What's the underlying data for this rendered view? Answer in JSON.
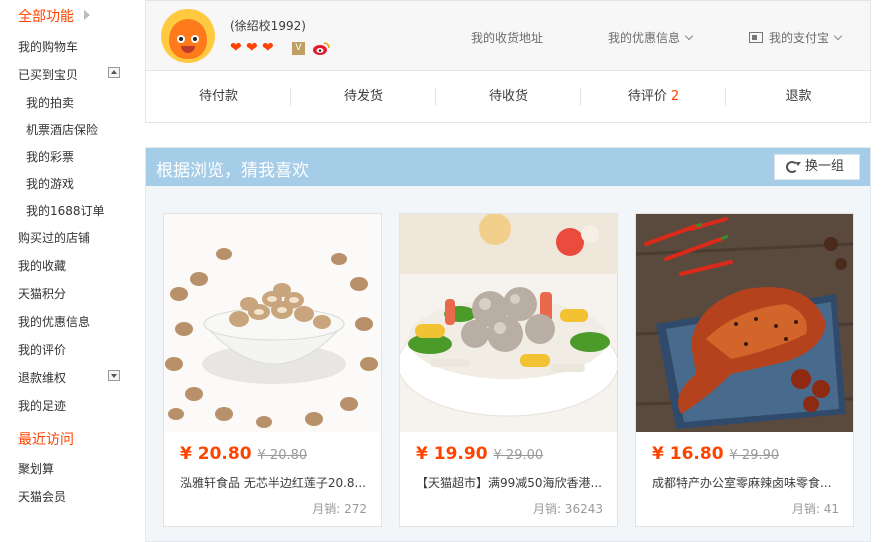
{
  "sidebar": {
    "all_features": "全部功能",
    "cart": "我的购物车",
    "bought": "已买到宝贝",
    "auction": "我的拍卖",
    "ticket_insurance": "机票酒店保险",
    "lottery": "我的彩票",
    "games": "我的游戏",
    "orders_1688": "我的1688订单",
    "visited_shops": "购买过的店铺",
    "favorites": "我的收藏",
    "tmall_points": "天猫积分",
    "coupons": "我的优惠信息",
    "reviews": "我的评价",
    "refunds": "退款维权",
    "footprints": "我的足迹",
    "recent_visits": "最近访问",
    "juhuasuan": "聚划算",
    "tmall_member": "天猫会员"
  },
  "user": {
    "name": "(徐绍校1992)",
    "nav_address": "我的收货地址",
    "nav_coupons": "我的优惠信息",
    "nav_alipay": "我的支付宝"
  },
  "orders": {
    "to_pay": "待付款",
    "to_ship": "待发货",
    "to_receive": "待收货",
    "to_review": "待评价",
    "to_review_count": "2",
    "refund": "退款"
  },
  "recommend": {
    "title": "根据浏览，猜我喜欢",
    "swap_button": "换一组",
    "products": [
      {
        "price": "¥ 20.80",
        "old_price": "¥ 20.80",
        "name": "泓雅轩食品 无芯半边红莲子20.8...",
        "sales": "月销: 272"
      },
      {
        "price": "¥ 19.90",
        "old_price": "¥ 29.00",
        "name": "【天猫超市】满99减50海欣香港...",
        "sales": "月销: 36243"
      },
      {
        "price": "¥ 16.80",
        "old_price": "¥ 29.90",
        "name": "成都特产办公室零麻辣卤味零食...",
        "sales": "月销: 41"
      }
    ]
  },
  "colors": {
    "accent": "#ff4400",
    "banner": "#a6cde8"
  }
}
